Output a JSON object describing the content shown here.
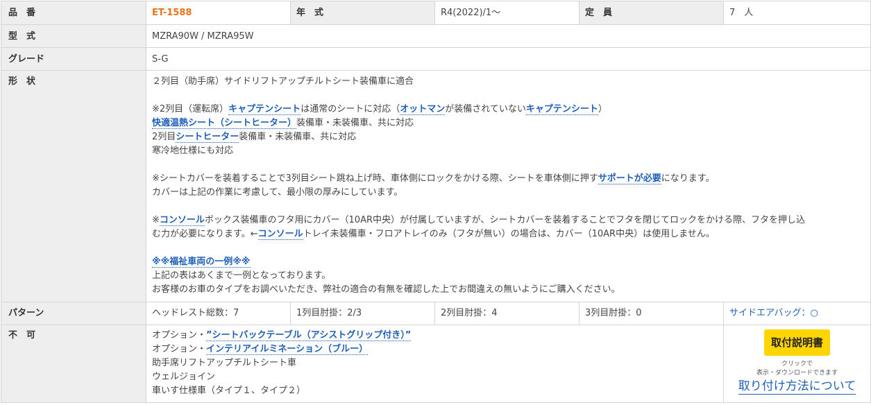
{
  "row1": {
    "part_no_label": "品　番",
    "part_no": "ET-1588",
    "year_label": "年　式",
    "year": "R4(2022)/1～",
    "capacity_label": "定　員",
    "capacity": "7　人"
  },
  "row2": {
    "label": "型　式",
    "value": "MZRA90W / MZRA95W"
  },
  "row3": {
    "label": "グレード",
    "value": "S-G"
  },
  "row4": {
    "label": "形　状",
    "line1": "２列目（助手席）サイドリフトアップチルトシート装備車に適合",
    "note1_a": "※2列目（運転席）",
    "captain_seat": "キャプテンシート",
    "note1_b": "は通常のシートに対応（",
    "ottoman": "オットマン",
    "note1_c": "が装備されていない",
    "captain_seat_2": "キャプテンシート",
    "note1_d": "）",
    "comfort_heat_seat": "快適温熱シート（シートヒーター）",
    "note2": "装備車・未装備車、共に対応",
    "note3_a": "2列目",
    "seat_heater": "シートヒーター",
    "note3_b": "装備車・未装備車、共に対応",
    "note4": "寒冷地仕様にも対応",
    "note5_a": "※シートカバーを装着することで3列目シート跳ね上げ時、車体側にロックをかける際、シートを車体側に押す",
    "support_needed": "サポートが必要",
    "note5_b": "になります。",
    "note6": "カバーは上記の作業に考慮して、最小限の厚みにしています。",
    "note7_a": "※",
    "console": "コンソール",
    "note7_b": "ボックス装備車のフタ用にカバー（10AR中央）が付属していますが、シートカバーを装着することでフタを閉じてロックをかける際、フタを押し込",
    "note8_a": "む力が必要になります。←",
    "console_2": "コンソール",
    "note8_b": "トレイ未装備車・フロアトレイのみ（フタが無い）の場合は、カバー（10AR中央）は使用しません。",
    "welfare": "※※福祉車両の一例※※",
    "note9": "上記の表はあくまで一例となっております。",
    "note10": "お客様のお車のタイプをお調べいただき、弊社の適合の有無を確認した上でお間違えの無いようにご購入ください。"
  },
  "row5": {
    "label": "パターン",
    "headrest": "ヘッドレスト総数：7",
    "armrest1": "1列目肘掛：2/3",
    "armrest2": "2列目肘掛：4",
    "armrest3": "3列目肘掛：0",
    "airbag": "サイドエアバッグ：○"
  },
  "row6": {
    "label": "不　可",
    "opt1_prefix": "オプション・",
    "opt1_link": "”シートバックテーブル（アシストグリップ付き）”",
    "opt2_prefix": "オプション・",
    "opt2_link": "インテリアイルミネーション（ブルー）",
    "item3": "助手席リフトアップチルトシート車",
    "item4": "ウェルジョイン",
    "item5": "車いす仕様車（タイプ１、タイプ２）",
    "manual_button": "取付説明書",
    "hint1": "クリックで",
    "hint2": "表示・ダウンロードできます",
    "howto_link": "取り付け方法について"
  }
}
